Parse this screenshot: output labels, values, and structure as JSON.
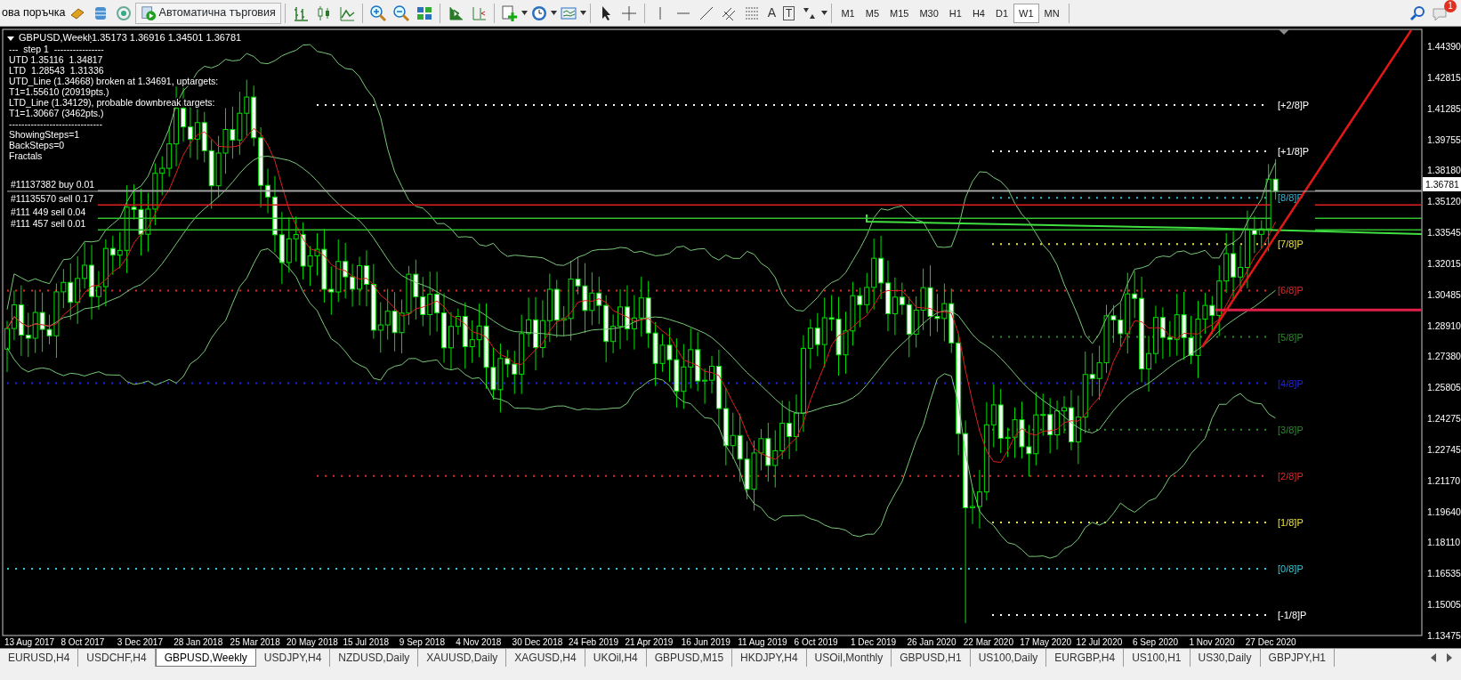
{
  "toolbar": {
    "new_order_label": "ова поръчка",
    "autotrading_label": "Автоматична търговия",
    "text_tool": "A",
    "label_tool": "T",
    "timeframes": [
      {
        "label": "M1",
        "selected": false
      },
      {
        "label": "M5",
        "selected": false
      },
      {
        "label": "M15",
        "selected": false
      },
      {
        "label": "M30",
        "selected": false
      },
      {
        "label": "H1",
        "selected": false
      },
      {
        "label": "H4",
        "selected": false
      },
      {
        "label": "D1",
        "selected": false
      },
      {
        "label": "W1",
        "selected": true
      },
      {
        "label": "MN",
        "selected": false
      }
    ],
    "notification_count": "1"
  },
  "chart": {
    "symbol": "GBPUSD,Weekly",
    "prices": "1.35173 1.36916 1.34501 1.36781",
    "info_lines": [
      "---  step 1  ----------------",
      "UTD 1.35116  1.34817",
      "LTD  1.28543  1.31336",
      "UTD_Line (1.34668) broken at 1.34691, uptargets:",
      "T1=1.55610 (20919pts.)",
      "LTD_Line (1.34129), probable downbreak targets:",
      "T1=1.30667 (3462pts.)",
      "------------------------------",
      "ShowingSteps=1",
      "BackSteps=0",
      "Fractals"
    ],
    "orders": [
      {
        "label": "#11137382 buy 0.01",
        "color": "#9aa09a"
      },
      {
        "label": "#11135570 sell 0.17",
        "color": "#e02020"
      },
      {
        "label": "#111 449 sell 0.04",
        "color": "#30c030"
      },
      {
        "label": "#111 457 sell 0.01",
        "color": "#30c030"
      }
    ],
    "murrey_levels": [
      {
        "label": "[+2/8]P",
        "color": "#ffffff"
      },
      {
        "label": "[+1/8]P",
        "color": "#ffffff"
      },
      {
        "label": "[8/8]P",
        "color": "#30b8d8"
      },
      {
        "label": "[7/8]P",
        "color": "#e8e040"
      },
      {
        "label": "[6/8]P",
        "color": "#e02828"
      },
      {
        "label": "[5/8]P",
        "color": "#2a8a2a"
      },
      {
        "label": "[4/8]P",
        "color": "#2020e8"
      },
      {
        "label": "[3/8]P",
        "color": "#2a8a2a"
      },
      {
        "label": "[2/8]P",
        "color": "#e02828"
      },
      {
        "label": "[1/8]P",
        "color": "#e8e040"
      },
      {
        "label": "[0/8]P",
        "color": "#30c8d8"
      },
      {
        "label": "[-1/8]P",
        "color": "#ffffff"
      }
    ],
    "price_axis": [
      "1.44390",
      "1.42815",
      "1.41285",
      "1.39755",
      "1.38180",
      "1.35120",
      "1.33545",
      "1.32015",
      "1.30485",
      "1.28910",
      "1.27380",
      "1.25805",
      "1.24275",
      "1.22745",
      "1.21170",
      "1.19640",
      "1.18110",
      "1.16535",
      "1.15005",
      "1.13475"
    ],
    "current_price": "1.36781",
    "time_axis": [
      "13 Aug 2017",
      "8 Oct 2017",
      "3 Dec 2017",
      "28 Jan 2018",
      "25 Mar 2018",
      "20 May 2018",
      "15 Jul 2018",
      "9 Sep 2018",
      "4 Nov 2018",
      "30 Dec 2018",
      "24 Feb 2019",
      "21 Apr 2019",
      "16 Jun 2019",
      "11 Aug 2019",
      "6 Oct 2019",
      "1 Dec 2019",
      "26 Jan 2020",
      "22 Mar 2020",
      "17 May 2020",
      "12 Jul 2020",
      "6 Sep 2020",
      "1 Nov 2020",
      "27 Dec 2020"
    ]
  },
  "tabs": [
    {
      "label": "EURUSD,H4",
      "selected": false
    },
    {
      "label": "USDCHF,H4",
      "selected": false
    },
    {
      "label": "GBPUSD,Weekly",
      "selected": true
    },
    {
      "label": "USDJPY,H4",
      "selected": false
    },
    {
      "label": "NZDUSD,Daily",
      "selected": false
    },
    {
      "label": "XAUUSD,Daily",
      "selected": false
    },
    {
      "label": "XAGUSD,H4",
      "selected": false
    },
    {
      "label": "UKOil,H4",
      "selected": false
    },
    {
      "label": "GBPUSD,M15",
      "selected": false
    },
    {
      "label": "HKDJPY,H4",
      "selected": false
    },
    {
      "label": "USOil,Monthly",
      "selected": false
    },
    {
      "label": "GBPUSD,H1",
      "selected": false
    },
    {
      "label": "US100,Daily",
      "selected": false
    },
    {
      "label": "EURGBP,H4",
      "selected": false
    },
    {
      "label": "US100,H1",
      "selected": false
    },
    {
      "label": "US30,Daily",
      "selected": false
    },
    {
      "label": "GBPJPY,H1",
      "selected": false
    }
  ]
}
